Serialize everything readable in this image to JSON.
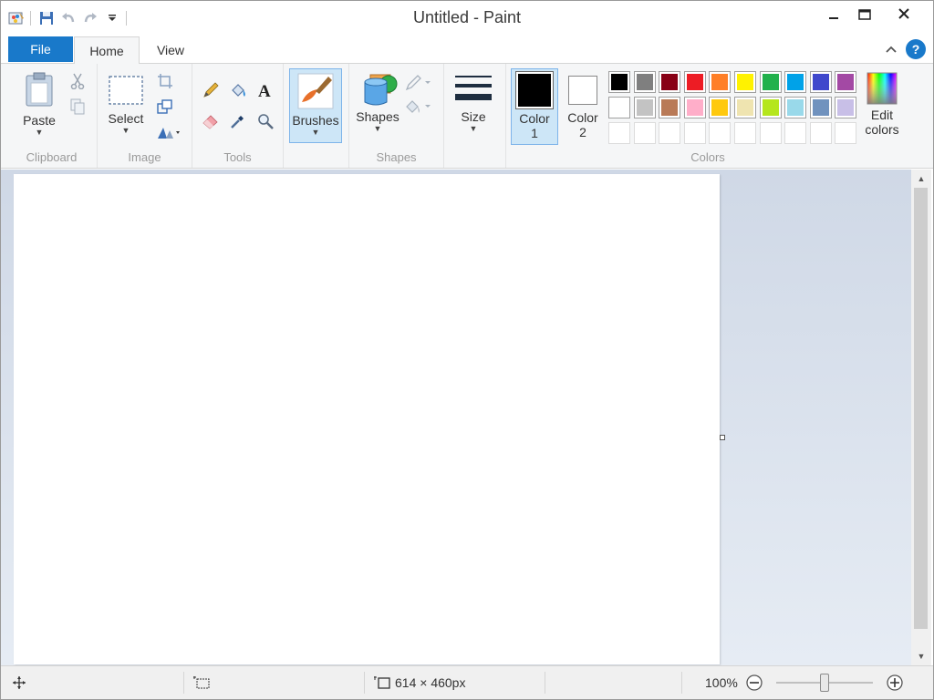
{
  "window": {
    "title": "Untitled - Paint"
  },
  "tabs": {
    "file": "File",
    "home": "Home",
    "view": "View"
  },
  "ribbon": {
    "clipboard": {
      "label": "Clipboard",
      "paste": "Paste"
    },
    "image": {
      "label": "Image",
      "select": "Select"
    },
    "tools": {
      "label": "Tools"
    },
    "brushes": {
      "label": "Brushes"
    },
    "shapes": {
      "label": "Shapes",
      "button": "Shapes"
    },
    "size": {
      "label": "Size"
    },
    "colors": {
      "label": "Colors",
      "color1": "Color\n1",
      "color2": "Color\n2",
      "edit": "Edit\ncolors",
      "color1_value": "#000000",
      "color2_value": "#ffffff",
      "palette_row1": [
        "#000000",
        "#7f7f7f",
        "#880015",
        "#ed1c24",
        "#ff7f27",
        "#fff200",
        "#22b14c",
        "#00a2e8",
        "#3f48cc",
        "#a349a4"
      ],
      "palette_row2": [
        "#ffffff",
        "#c3c3c3",
        "#b97a57",
        "#ffaec9",
        "#ffc90e",
        "#efe4b0",
        "#b5e61d",
        "#99d9ea",
        "#7092be",
        "#c8bfe7"
      ]
    }
  },
  "status": {
    "dimensions": "614 × 460px",
    "zoom": "100%"
  }
}
